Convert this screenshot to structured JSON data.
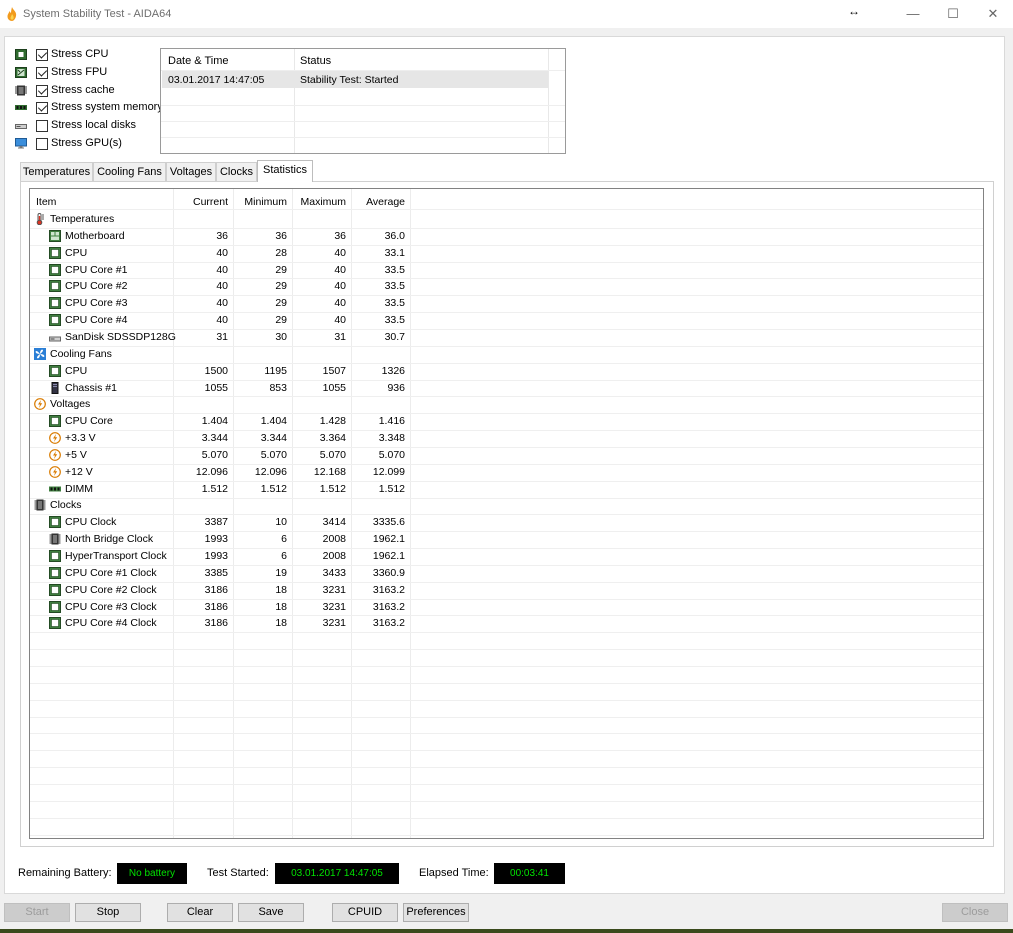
{
  "window": {
    "title": "System Stability Test - AIDA64",
    "resize_glyph": "↔",
    "minimize": "—",
    "maximize": "☐",
    "close": "✕"
  },
  "stress": [
    {
      "label": "Stress CPU",
      "checked": true,
      "icon": "cpu-icon"
    },
    {
      "label": "Stress FPU",
      "checked": true,
      "icon": "fpu-icon"
    },
    {
      "label": "Stress cache",
      "checked": true,
      "icon": "cache-icon"
    },
    {
      "label": "Stress system memory",
      "checked": true,
      "icon": "memory-icon"
    },
    {
      "label": "Stress local disks",
      "checked": false,
      "icon": "disk-icon"
    },
    {
      "label": "Stress GPU(s)",
      "checked": false,
      "icon": "gpu-icon"
    }
  ],
  "log": {
    "col_date": "Date & Time",
    "col_status": "Status",
    "rows": [
      {
        "date": "03.01.2017 14:47:05",
        "status": "Stability Test: Started"
      }
    ]
  },
  "tabs": [
    "Temperatures",
    "Cooling Fans",
    "Voltages",
    "Clocks",
    "Statistics"
  ],
  "active_tab": "Statistics",
  "stats": {
    "headers": {
      "item": "Item",
      "current": "Current",
      "minimum": "Minimum",
      "maximum": "Maximum",
      "average": "Average"
    },
    "rows": [
      {
        "group": true,
        "name": "Temperatures",
        "icon": "thermometer-icon"
      },
      {
        "name": "Motherboard",
        "icon": "motherboard-icon",
        "cur": "36",
        "min": "36",
        "max": "36",
        "avg": "36.0"
      },
      {
        "name": "CPU",
        "icon": "cpu-chip-icon",
        "cur": "40",
        "min": "28",
        "max": "40",
        "avg": "33.1"
      },
      {
        "name": "CPU Core #1",
        "icon": "cpu-chip-icon",
        "cur": "40",
        "min": "29",
        "max": "40",
        "avg": "33.5"
      },
      {
        "name": "CPU Core #2",
        "icon": "cpu-chip-icon",
        "cur": "40",
        "min": "29",
        "max": "40",
        "avg": "33.5"
      },
      {
        "name": "CPU Core #3",
        "icon": "cpu-chip-icon",
        "cur": "40",
        "min": "29",
        "max": "40",
        "avg": "33.5"
      },
      {
        "name": "CPU Core #4",
        "icon": "cpu-chip-icon",
        "cur": "40",
        "min": "29",
        "max": "40",
        "avg": "33.5"
      },
      {
        "name": "SanDisk SDSSDP128G",
        "icon": "drive-icon",
        "cur": "31",
        "min": "30",
        "max": "31",
        "avg": "30.7"
      },
      {
        "group": true,
        "name": "Cooling Fans",
        "icon": "fan-icon"
      },
      {
        "name": "CPU",
        "icon": "cpu-chip-icon",
        "cur": "1500",
        "min": "1195",
        "max": "1507",
        "avg": "1326"
      },
      {
        "name": "Chassis #1",
        "icon": "chassis-icon",
        "cur": "1055",
        "min": "853",
        "max": "1055",
        "avg": "936"
      },
      {
        "group": true,
        "name": "Voltages",
        "icon": "voltage-icon"
      },
      {
        "name": "CPU Core",
        "icon": "cpu-chip-icon",
        "cur": "1.404",
        "min": "1.404",
        "max": "1.428",
        "avg": "1.416"
      },
      {
        "name": "+3.3 V",
        "icon": "voltage-icon",
        "cur": "3.344",
        "min": "3.344",
        "max": "3.364",
        "avg": "3.348"
      },
      {
        "name": "+5 V",
        "icon": "voltage-icon",
        "cur": "5.070",
        "min": "5.070",
        "max": "5.070",
        "avg": "5.070"
      },
      {
        "name": "+12 V",
        "icon": "voltage-icon",
        "cur": "12.096",
        "min": "12.096",
        "max": "12.168",
        "avg": "12.099"
      },
      {
        "name": "DIMM",
        "icon": "memory-icon",
        "cur": "1.512",
        "min": "1.512",
        "max": "1.512",
        "avg": "1.512"
      },
      {
        "group": true,
        "name": "Clocks",
        "icon": "clock-chip-icon"
      },
      {
        "name": "CPU Clock",
        "icon": "cpu-chip-icon",
        "cur": "3387",
        "min": "10",
        "max": "3414",
        "avg": "3335.6"
      },
      {
        "name": "North Bridge Clock",
        "icon": "clock-chip-icon",
        "cur": "1993",
        "min": "6",
        "max": "2008",
        "avg": "1962.1"
      },
      {
        "name": "HyperTransport Clock",
        "icon": "cpu-chip-icon",
        "cur": "1993",
        "min": "6",
        "max": "2008",
        "avg": "1962.1"
      },
      {
        "name": "CPU Core #1 Clock",
        "icon": "cpu-chip-icon",
        "cur": "3385",
        "min": "19",
        "max": "3433",
        "avg": "3360.9"
      },
      {
        "name": "CPU Core #2 Clock",
        "icon": "cpu-chip-icon",
        "cur": "3186",
        "min": "18",
        "max": "3231",
        "avg": "3163.2"
      },
      {
        "name": "CPU Core #3 Clock",
        "icon": "cpu-chip-icon",
        "cur": "3186",
        "min": "18",
        "max": "3231",
        "avg": "3163.2"
      },
      {
        "name": "CPU Core #4 Clock",
        "icon": "cpu-chip-icon",
        "cur": "3186",
        "min": "18",
        "max": "3231",
        "avg": "3163.2"
      }
    ]
  },
  "status": {
    "battery_label": "Remaining Battery:",
    "battery_value": "No battery",
    "started_label": "Test Started:",
    "started_value": "03.01.2017 14:47:05",
    "elapsed_label": "Elapsed Time:",
    "elapsed_value": "00:03:41"
  },
  "buttons": {
    "start": "Start",
    "stop": "Stop",
    "clear": "Clear",
    "save": "Save",
    "cpuid": "CPUID",
    "preferences": "Preferences",
    "close": "Close"
  },
  "colors": {
    "lcd_text": "#00e400",
    "lcd_bg": "#000000",
    "chip_green": "#3f7f3f"
  }
}
